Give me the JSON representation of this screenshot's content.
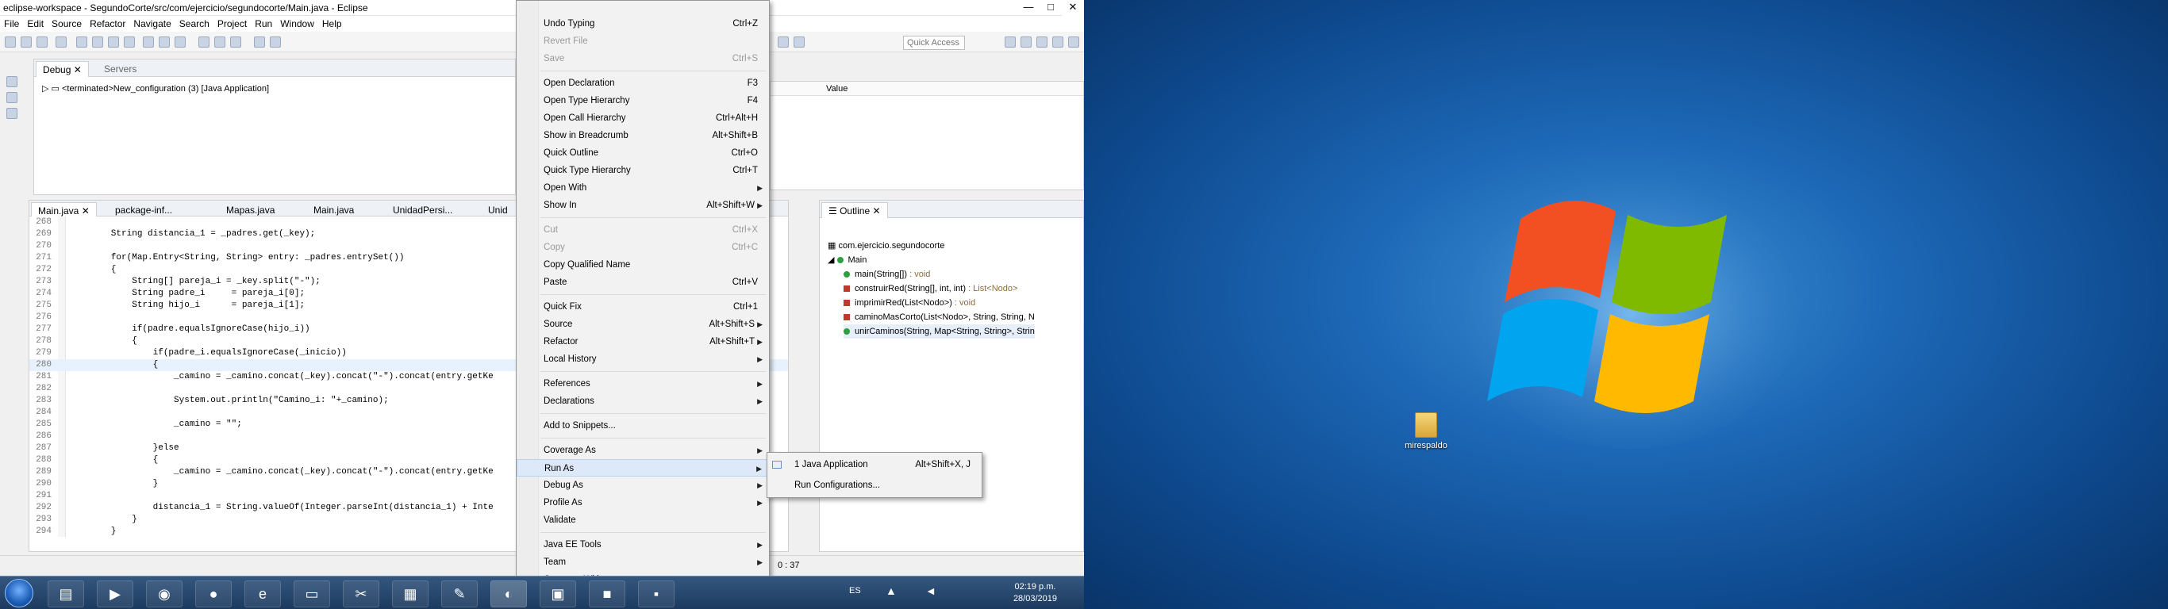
{
  "window": {
    "title": "eclipse-workspace - SegundoCorte/src/com/ejercicio/segundocorte/Main.java - Eclipse",
    "minimize": "—",
    "maximize": "□",
    "close": "✕"
  },
  "menubar": [
    "File",
    "Edit",
    "Source",
    "Refactor",
    "Navigate",
    "Search",
    "Project",
    "Run",
    "Window",
    "Help"
  ],
  "toolbar": {
    "quick_access_placeholder": "Quick Access"
  },
  "debug_view": {
    "tabs": [
      "Debug",
      "Servers"
    ],
    "tree_item": "<terminated>New_configuration (3) [Java Application]"
  },
  "variables_view": {
    "columns": [
      "Value"
    ]
  },
  "editor": {
    "tabs": [
      "Main.java",
      "package-inf...",
      "Mapas.java",
      "Main.java",
      "UnidadPersi...",
      "Unid"
    ],
    "lines": [
      {
        "n": "268",
        "code": ""
      },
      {
        "n": "269",
        "code": "        String distancia_1 = _padres.get(_key);"
      },
      {
        "n": "270",
        "code": ""
      },
      {
        "n": "271",
        "code": "        for(Map.Entry<String, String> entry: _padres.entrySet())"
      },
      {
        "n": "272",
        "code": "        {"
      },
      {
        "n": "273",
        "code": "            String[] pareja_i = _key.split(\"-\");"
      },
      {
        "n": "274",
        "code": "            String padre_i     = pareja_i[0];"
      },
      {
        "n": "275",
        "code": "            String hijo_i      = pareja_i[1];"
      },
      {
        "n": "276",
        "code": ""
      },
      {
        "n": "277",
        "code": "            if(padre.equalsIgnoreCase(hijo_i))"
      },
      {
        "n": "278",
        "code": "            {"
      },
      {
        "n": "279",
        "code": "                if(padre_i.equalsIgnoreCase(_inicio))"
      },
      {
        "n": "280",
        "code": "                {"
      },
      {
        "n": "281",
        "code": "                    _camino = _camino.concat(_key).concat(\"-\").concat(entry.getKe"
      },
      {
        "n": "282",
        "code": ""
      },
      {
        "n": "283",
        "code": "                    System.out.println(\"Camino_i: \"+_camino);"
      },
      {
        "n": "284",
        "code": ""
      },
      {
        "n": "285",
        "code": "                    _camino = \"\";"
      },
      {
        "n": "286",
        "code": ""
      },
      {
        "n": "287",
        "code": "                }else"
      },
      {
        "n": "288",
        "code": "                {"
      },
      {
        "n": "289",
        "code": "                    _camino = _camino.concat(_key).concat(\"-\").concat(entry.getKe"
      },
      {
        "n": "290",
        "code": "                }"
      },
      {
        "n": "291",
        "code": ""
      },
      {
        "n": "292",
        "code": "                distancia_1 = String.valueOf(Integer.parseInt(distancia_1) + Inte"
      },
      {
        "n": "293",
        "code": "            }"
      },
      {
        "n": "294",
        "code": "        }"
      }
    ]
  },
  "outline": {
    "title": "Outline",
    "package": "com.ejercicio.segundocorte",
    "class": "Main",
    "members": [
      {
        "name": "main(String[])",
        "type": " : void",
        "color": "#2e9e3e"
      },
      {
        "name": "construirRed(String[], int, int)",
        "type": " : List<Nodo>",
        "color": "#c0392b"
      },
      {
        "name": "imprimirRed(List<Nodo>)",
        "type": " : void",
        "color": "#c0392b"
      },
      {
        "name": "caminoMasCorto(List<Nodo>, String, String, N",
        "type": "",
        "color": "#c0392b"
      },
      {
        "name": "unirCaminos(String, Map<String, String>, Strin",
        "type": "",
        "color": "#2e9e3e"
      }
    ]
  },
  "statusbar": {
    "position": "0 : 37"
  },
  "context_menu": {
    "items": [
      {
        "label": "Undo Typing",
        "shortcut": "Ctrl+Z",
        "disabled": false
      },
      {
        "label": "Revert File",
        "shortcut": "",
        "disabled": true
      },
      {
        "label": "Save",
        "shortcut": "Ctrl+S",
        "disabled": true
      },
      {
        "label": "Open Declaration",
        "shortcut": "F3",
        "disabled": false
      },
      {
        "label": "Open Type Hierarchy",
        "shortcut": "F4",
        "disabled": false
      },
      {
        "label": "Open Call Hierarchy",
        "shortcut": "Ctrl+Alt+H",
        "disabled": false
      },
      {
        "label": "Show in Breadcrumb",
        "shortcut": "Alt+Shift+B",
        "disabled": false
      },
      {
        "label": "Quick Outline",
        "shortcut": "Ctrl+O",
        "disabled": false
      },
      {
        "label": "Quick Type Hierarchy",
        "shortcut": "Ctrl+T",
        "disabled": false
      },
      {
        "label": "Open With",
        "shortcut": "",
        "disabled": false,
        "submenu": true
      },
      {
        "label": "Show In",
        "shortcut": "Alt+Shift+W",
        "disabled": false,
        "submenu": true
      },
      {
        "label": "Cut",
        "shortcut": "Ctrl+X",
        "disabled": true
      },
      {
        "label": "Copy",
        "shortcut": "Ctrl+C",
        "disabled": true
      },
      {
        "label": "Copy Qualified Name",
        "shortcut": "",
        "disabled": false
      },
      {
        "label": "Paste",
        "shortcut": "Ctrl+V",
        "disabled": false
      },
      {
        "label": "Quick Fix",
        "shortcut": "Ctrl+1",
        "disabled": false
      },
      {
        "label": "Source",
        "shortcut": "Alt+Shift+S",
        "disabled": false,
        "submenu": true
      },
      {
        "label": "Refactor",
        "shortcut": "Alt+Shift+T",
        "disabled": false,
        "submenu": true
      },
      {
        "label": "Local History",
        "shortcut": "",
        "disabled": false,
        "submenu": true
      },
      {
        "label": "References",
        "shortcut": "",
        "disabled": false,
        "submenu": true
      },
      {
        "label": "Declarations",
        "shortcut": "",
        "disabled": false,
        "submenu": true
      },
      {
        "label": "Add to Snippets...",
        "shortcut": "",
        "disabled": false
      },
      {
        "label": "Coverage As",
        "shortcut": "",
        "disabled": false,
        "submenu": true
      },
      {
        "label": "Run As",
        "shortcut": "",
        "disabled": false,
        "submenu": true,
        "highlighted": true
      },
      {
        "label": "Debug As",
        "shortcut": "",
        "disabled": false,
        "submenu": true
      },
      {
        "label": "Profile As",
        "shortcut": "",
        "disabled": false,
        "submenu": true
      },
      {
        "label": "Validate",
        "shortcut": "",
        "disabled": false
      },
      {
        "label": "Java EE Tools",
        "shortcut": "",
        "disabled": false,
        "submenu": true
      },
      {
        "label": "Team",
        "shortcut": "",
        "disabled": false,
        "submenu": true
      },
      {
        "label": "Compare With",
        "shortcut": "",
        "disabled": false,
        "submenu": true
      }
    ]
  },
  "run_as_submenu": {
    "items": [
      {
        "label": "1 Java Application",
        "shortcut": "Alt+Shift+X, J"
      },
      {
        "label": "Run Configurations...",
        "shortcut": ""
      }
    ]
  },
  "desktop": {
    "icon_label": "mirespaldo"
  },
  "taskbar": {
    "language": "ES",
    "time": "02:19 p.m.",
    "date": "28/03/2019"
  }
}
